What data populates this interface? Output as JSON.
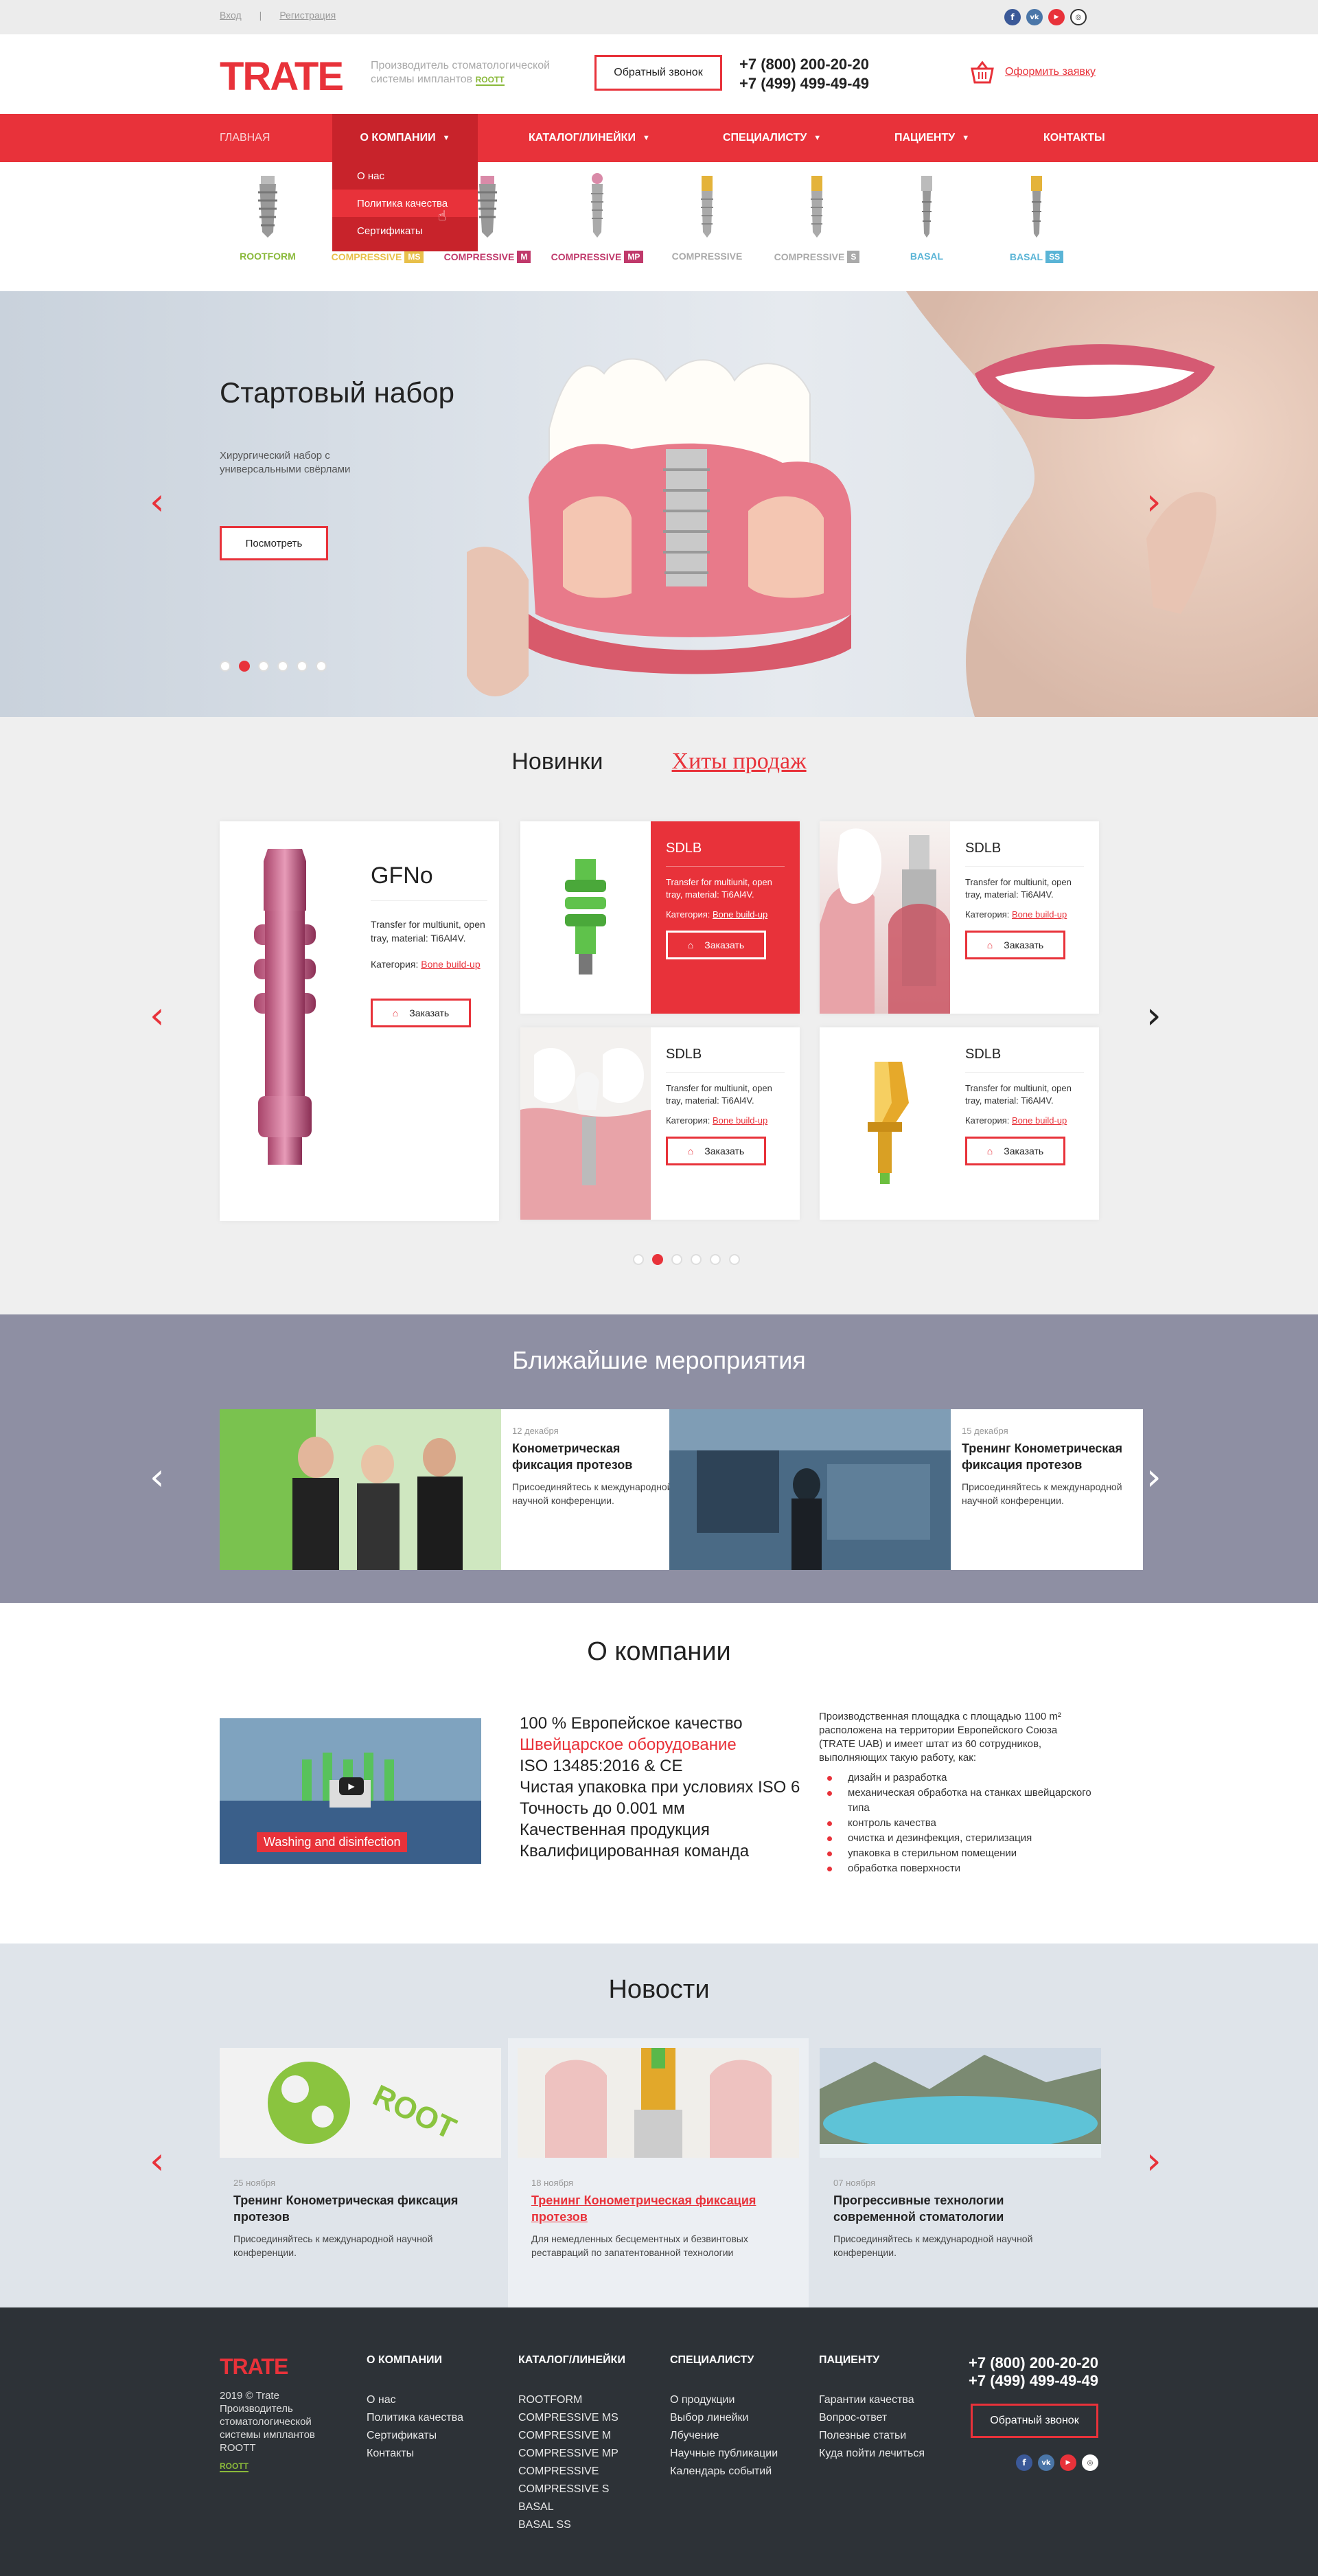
{
  "topbar": {
    "login": "Вход",
    "sep": "|",
    "register": "Регистрация"
  },
  "header": {
    "logo": "TRATE",
    "tagline": "Производитель стоматологической системы имплантов",
    "tagline_brand": "ROOTT",
    "callback": "Обратный звонок",
    "phone1": "+7 (800) 200-20-20",
    "phone2": "+7 (499) 499-49-49",
    "order": "Оформить заявку"
  },
  "nav": {
    "home": "ГЛАВНАЯ",
    "company": "О КОМПАНИИ",
    "catalog": "КАТАЛОГ/ЛИНЕЙКИ",
    "specialist": "СПЕЦИАЛИСТУ",
    "patient": "ПАЦИЕНТУ",
    "contacts": "КОНТАКТЫ"
  },
  "dropdown": {
    "items": [
      "О нас",
      "Политика качества",
      "Сертификаты"
    ]
  },
  "products": [
    {
      "name": "ROOTFORM",
      "tag": "",
      "color": "#8ab93a"
    },
    {
      "name": "COMPRESSIVE",
      "tag": "MS",
      "color": "#e8c04a"
    },
    {
      "name": "COMPRESSIVE",
      "tag": "M",
      "color": "#c0396b"
    },
    {
      "name": "COMPRESSIVE",
      "tag": "MP",
      "color": "#c0396b"
    },
    {
      "name": "COMPRESSIVE",
      "tag": "",
      "color": "#aaaaaa"
    },
    {
      "name": "COMPRESSIVE",
      "tag": "S",
      "color": "#aaaaaa"
    },
    {
      "name": "BASAL",
      "tag": "",
      "color": "#5ab4d6"
    },
    {
      "name": "BASAL",
      "tag": "SS",
      "color": "#5ab4d6"
    }
  ],
  "hero": {
    "title": "Стартовый набор",
    "text": "Хирургический набор с универсальными свёрлами",
    "button": "Посмотреть",
    "active_dot": 2,
    "dot_count": 6
  },
  "new": {
    "tab_new": "Новинки",
    "tab_hits": "Хиты продаж",
    "big": {
      "title": "GFNo",
      "desc": "Transfer for multiunit, open tray, material: Ti6Al4V.",
      "cat_label": "Категория:",
      "cat": "Bone build-up",
      "button": "Заказать"
    },
    "cards": [
      {
        "title": "SDLB",
        "desc": "Transfer for multiunit, open tray, material: Ti6Al4V.",
        "cat_label": "Категория:",
        "cat": "Bone build-up",
        "button": "Заказать"
      },
      {
        "title": "SDLB",
        "desc": "Transfer for multiunit, open tray, material: Ti6Al4V.",
        "cat_label": "Категория:",
        "cat": "Bone build-up",
        "button": "Заказать"
      },
      {
        "title": "SDLB",
        "desc": "Transfer for multiunit, open tray, material: Ti6Al4V.",
        "cat_label": "Категория:",
        "cat": "Bone build-up",
        "button": "Заказать"
      },
      {
        "title": "SDLB",
        "desc": "Transfer for multiunit, open tray, material: Ti6Al4V.",
        "cat_label": "Категория:",
        "cat": "Bone build-up",
        "button": "Заказать"
      }
    ]
  },
  "events": {
    "title": "Ближайшие мероприятия",
    "items": [
      {
        "date": "12 декабря",
        "title": "Конометрическая фиксация протезов",
        "desc": "Присоединяйтесь к международной научной конференции."
      },
      {
        "date": "15 декабря",
        "title": "Тренинг Конометрическая фиксация протезов",
        "desc": "Присоединяйтесь к международной научной конференции."
      }
    ]
  },
  "about": {
    "title": "О компании",
    "video_caption": "Washing and disinfection",
    "facts": [
      "100 % Европейское качество",
      "Швейцарское оборудование",
      "ISO 13485:2016 & CE",
      "Чистая упаковка при условиях ISO 6",
      "Точность до 0.001 мм",
      "Качественная продукция",
      "Квалифицированная команда"
    ],
    "text": "Производственная площадка с площадью 1100 m² расположена на территории Европейского Союза (TRATE UAB) и имеет штат из 60 сотрудников, выполняющих такую работу, как:",
    "list": [
      "дизайн и разработка",
      "механическая обработка на станках швейцарского типа",
      "контроль качества",
      "очистка и дезинфекция, стерилизация",
      "упаковка в стерильном помещении",
      "обработка поверхности"
    ]
  },
  "news": {
    "title": "Новости",
    "items": [
      {
        "date": "25 ноября",
        "title": "Тренинг Конометрическая фиксация протезов",
        "desc": "Присоединяйтесь к международной научной конференции."
      },
      {
        "date": "18 ноября",
        "title": "Тренинг Конометрическая фиксация протезов",
        "desc": "Для немедленных бесцементных и безвинтовых реставраций по запатентованной технологии"
      },
      {
        "date": "07 ноября",
        "title": "Прогрессивные технологии современной стоматологии",
        "desc": "Присоединяйтесь к международной научной конференции."
      }
    ]
  },
  "footer": {
    "logo": "TRATE",
    "copy": "2019 © Trate Производитель стоматологической системы имплантов ROOTT",
    "brand": "ROOTT",
    "col1": {
      "h": "О КОМПАНИИ",
      "items": [
        "О нас",
        "Политика качества",
        "Сертификаты",
        "Контакты"
      ]
    },
    "col2": {
      "h": "КАТАЛОГ/ЛИНЕЙКИ",
      "items": [
        "ROOTFORM",
        "COMPRESSIVE MS",
        "COMPRESSIVE M",
        "COMPRESSIVE MP",
        "COMPRESSIVE",
        "COMPRESSIVE  S",
        "BASAL",
        "BASAL SS"
      ]
    },
    "col3": {
      "h": "СПЕЦИАЛИСТУ",
      "items": [
        "О продукции",
        "Выбор линейки",
        "Лбучение",
        "Научные публикации",
        "Календарь событий"
      ]
    },
    "col4": {
      "h": "ПАЦИЕНТУ",
      "items": [
        "Гарантии качества",
        "Вопрос-ответ",
        "Полезные статьи",
        "Куда пойти лечиться"
      ]
    },
    "phone1": "+7 (800) 200-20-20",
    "phone2": "+7 (499) 499-49-49",
    "callback": "Обратный звонок"
  },
  "social_icons": [
    "facebook-icon",
    "vk-icon",
    "youtube-icon",
    "instagram-icon"
  ],
  "colors": {
    "accent": "#e8323a",
    "footer": "#2d3237",
    "events": "#8e8fa3"
  }
}
